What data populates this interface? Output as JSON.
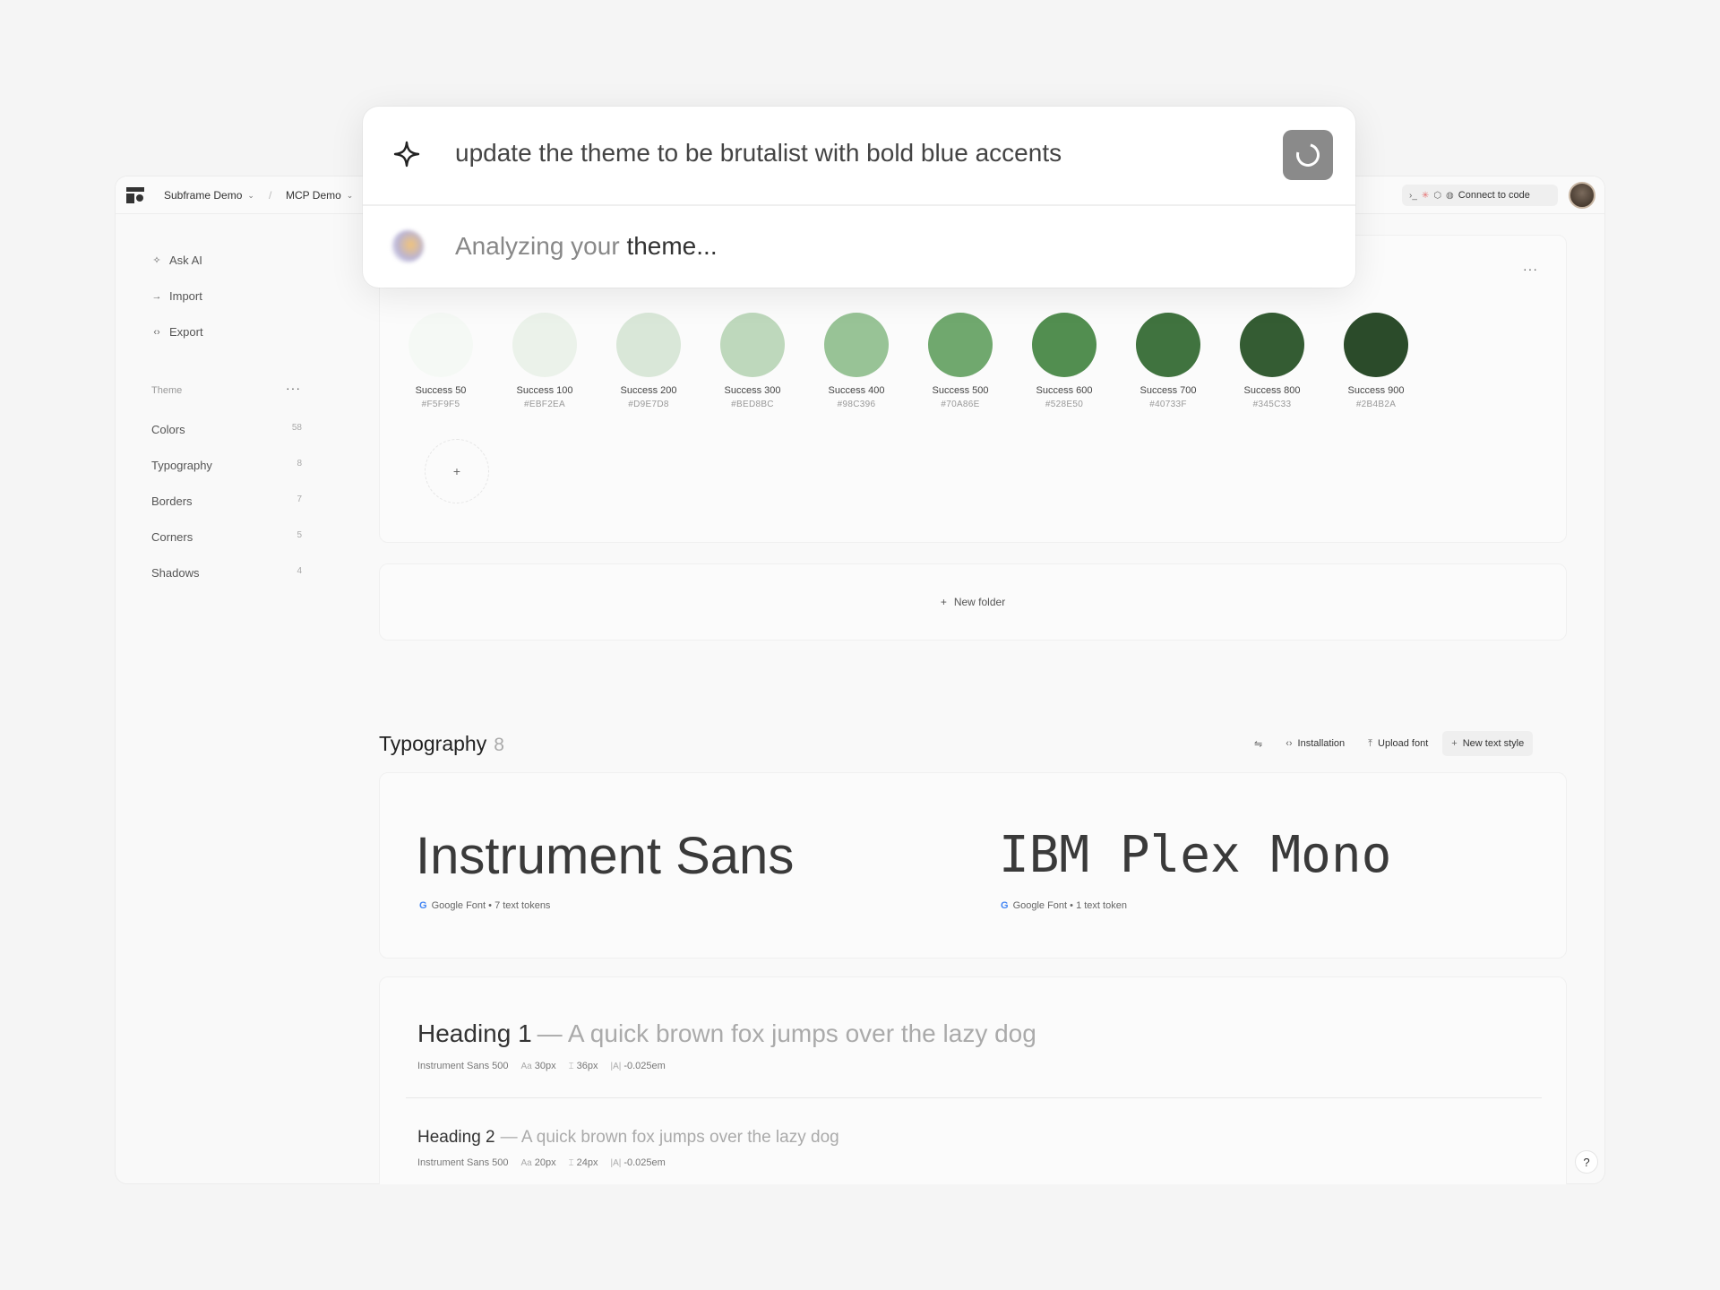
{
  "topbar": {
    "project": "Subframe Demo",
    "page": "MCP Demo",
    "connect_label": "Connect to code"
  },
  "sidebar": {
    "actions": [
      {
        "label": "Ask AI",
        "icon": "sparkle-icon"
      },
      {
        "label": "Import",
        "icon": "arrow-right-icon"
      },
      {
        "label": "Export",
        "icon": "code-icon"
      }
    ],
    "section_title": "Theme",
    "items": [
      {
        "label": "Colors",
        "count": "58"
      },
      {
        "label": "Typography",
        "count": "8"
      },
      {
        "label": "Borders",
        "count": "7"
      },
      {
        "label": "Corners",
        "count": "5"
      },
      {
        "label": "Shadows",
        "count": "4"
      }
    ]
  },
  "colors": {
    "swatches": [
      {
        "name": "Success 50",
        "hex": "#F5F9F5"
      },
      {
        "name": "Success 100",
        "hex": "#EBF2EA"
      },
      {
        "name": "Success 200",
        "hex": "#D9E7D8"
      },
      {
        "name": "Success 300",
        "hex": "#BED8BC"
      },
      {
        "name": "Success 400",
        "hex": "#98C396"
      },
      {
        "name": "Success 500",
        "hex": "#70A86E"
      },
      {
        "name": "Success 600",
        "hex": "#528E50"
      },
      {
        "name": "Success 700",
        "hex": "#40733F"
      },
      {
        "name": "Success 800",
        "hex": "#345C33"
      },
      {
        "name": "Success 900",
        "hex": "#2B4B2A"
      }
    ],
    "add_label": "+",
    "new_folder_label": "New folder"
  },
  "typography": {
    "title": "Typography",
    "count": "8",
    "actions": {
      "installation": "Installation",
      "upload": "Upload font",
      "new_style": "New text style"
    },
    "fonts": [
      {
        "name": "Instrument Sans",
        "meta": "Google Font • 7 text tokens"
      },
      {
        "name": "IBM Plex Mono",
        "meta": "Google Font • 1 text token"
      }
    ],
    "styles": [
      {
        "name": "Heading 1",
        "sample": "— A quick brown fox jumps over the lazy dog",
        "font": "Instrument Sans 500",
        "size": "30px",
        "line_height": "36px",
        "letter_spacing": "-0.025em"
      },
      {
        "name": "Heading 2",
        "sample": "— A quick brown fox jumps over the lazy dog",
        "font": "Instrument Sans 500",
        "size": "20px",
        "line_height": "24px",
        "letter_spacing": "-0.025em"
      }
    ]
  },
  "ai": {
    "prompt": "update the theme to be brutalist with bold blue accents",
    "status_a": "Analyzing your",
    "status_b": "theme..."
  },
  "help_label": "?"
}
